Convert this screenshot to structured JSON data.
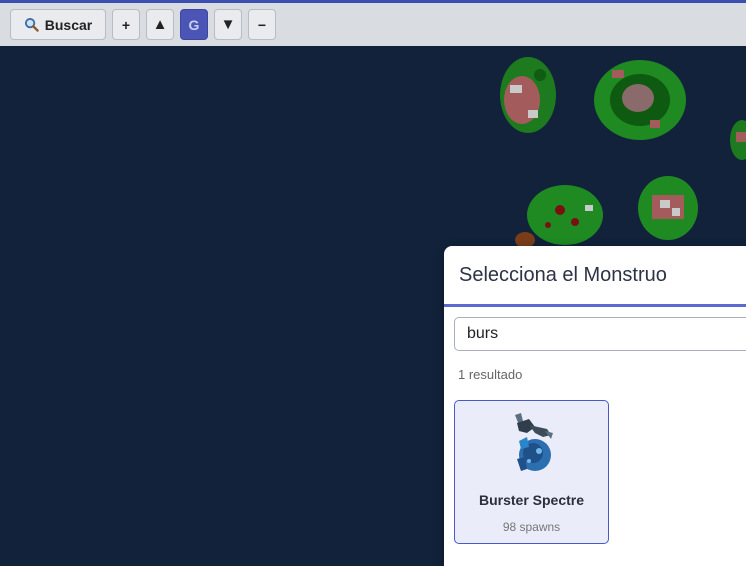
{
  "toolbar": {
    "search_label": "Buscar",
    "zoom_in": "+",
    "floor_up": "▲",
    "grid": "G",
    "floor_down": "▼",
    "zoom_out": "−"
  },
  "modal": {
    "title": "Selecciona el Monstruo",
    "search_value": "burs",
    "result_count": "1 resultado",
    "results": [
      {
        "name": "Burster Spectre",
        "spawns": "98 spawns"
      }
    ]
  }
}
